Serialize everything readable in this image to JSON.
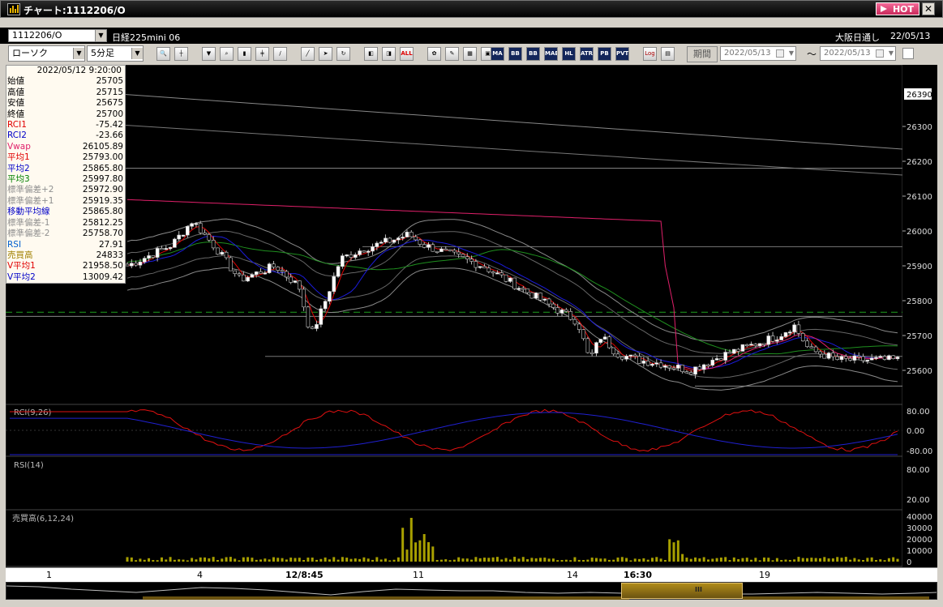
{
  "window": {
    "title": "チャート:1112206/O",
    "hot_label": "HOT",
    "close_label": "✕"
  },
  "symbol": {
    "code": "1112206/O",
    "name": "日経225mini 06",
    "session": "大阪日通し",
    "date": "22/05/13"
  },
  "toolbar": {
    "chart_type": "ローソク",
    "interval": "5分足",
    "period_label": "期間",
    "date_from": "2022/05/13",
    "date_to": "2022/05/13",
    "tilde": "〜",
    "button_labels": [
      "ALL",
      "MA",
      "BB",
      "MAE",
      "HL",
      "ATR",
      "PB SA",
      "PVT",
      "Log"
    ]
  },
  "ohlc_panel": {
    "datetime": "2022/05/12 9:20:00",
    "rows": [
      {
        "label": "始値",
        "value": "25705",
        "color": "#000000"
      },
      {
        "label": "高値",
        "value": "25715",
        "color": "#000000"
      },
      {
        "label": "安値",
        "value": "25675",
        "color": "#000000"
      },
      {
        "label": "終値",
        "value": "25700",
        "color": "#000000"
      },
      {
        "label": "RCI1",
        "value": "-75.42",
        "color": "#e00000"
      },
      {
        "label": "RCI2",
        "value": "-23.66",
        "color": "#0000c8"
      },
      {
        "label": "Vwap",
        "value": "26105.89",
        "color": "#e0206a"
      },
      {
        "label": "平均1",
        "value": "25793.00",
        "color": "#e00000"
      },
      {
        "label": "平均2",
        "value": "25865.80",
        "color": "#0000c8"
      },
      {
        "label": "平均3",
        "value": "25997.80",
        "color": "#008000"
      },
      {
        "label": "標準偏差+2",
        "value": "25972.90",
        "color": "#909090"
      },
      {
        "label": "標準偏差+1",
        "value": "25919.35",
        "color": "#909090"
      },
      {
        "label": "移動平均線",
        "value": "25865.80",
        "color": "#0000c8"
      },
      {
        "label": "標準偏差-1",
        "value": "25812.25",
        "color": "#909090"
      },
      {
        "label": "標準偏差-2",
        "value": "25758.70",
        "color": "#909090"
      },
      {
        "label": "RSI",
        "value": "27.91",
        "color": "#0060d0"
      },
      {
        "label": "売買高",
        "value": "24833",
        "color": "#a08000"
      },
      {
        "label": "V平均1",
        "value": "21958.50",
        "color": "#e00000"
      },
      {
        "label": "V平均2",
        "value": "13009.42",
        "color": "#0000c8"
      }
    ]
  },
  "price_axis": {
    "current_price": "26390",
    "ticks": [
      "26300",
      "26200",
      "26100",
      "26000",
      "25900",
      "25800",
      "25700",
      "25600"
    ]
  },
  "rci_panel": {
    "label": "RCI(9,26)",
    "ticks": [
      "80.00",
      "0.00",
      "-80.00"
    ]
  },
  "rsi_panel": {
    "label": "RSI(14)",
    "ticks": [
      "80.00",
      "20.00"
    ]
  },
  "volume_panel": {
    "label": "売買高(6,12,24)",
    "ticks": [
      "40000",
      "30000",
      "20000",
      "10000",
      "0"
    ]
  },
  "x_axis": {
    "labels": [
      {
        "text": "1",
        "bold": false
      },
      {
        "text": "4",
        "bold": false
      },
      {
        "text": "12/8:45",
        "bold": true
      },
      {
        "text": "11",
        "bold": false
      },
      {
        "text": "14",
        "bold": false
      },
      {
        "text": "16:30",
        "bold": true
      },
      {
        "text": "19",
        "bold": false
      }
    ]
  },
  "colors": {
    "background": "#000000",
    "bull_candle": "#ffffff",
    "bear_candle": "#000000",
    "ma1": "#e00000",
    "ma2": "#1c1cdc",
    "ma3": "#1f8f1f",
    "vwap": "#e0206a",
    "bands": "#8a8a8a",
    "volume": "#a8a000"
  }
}
